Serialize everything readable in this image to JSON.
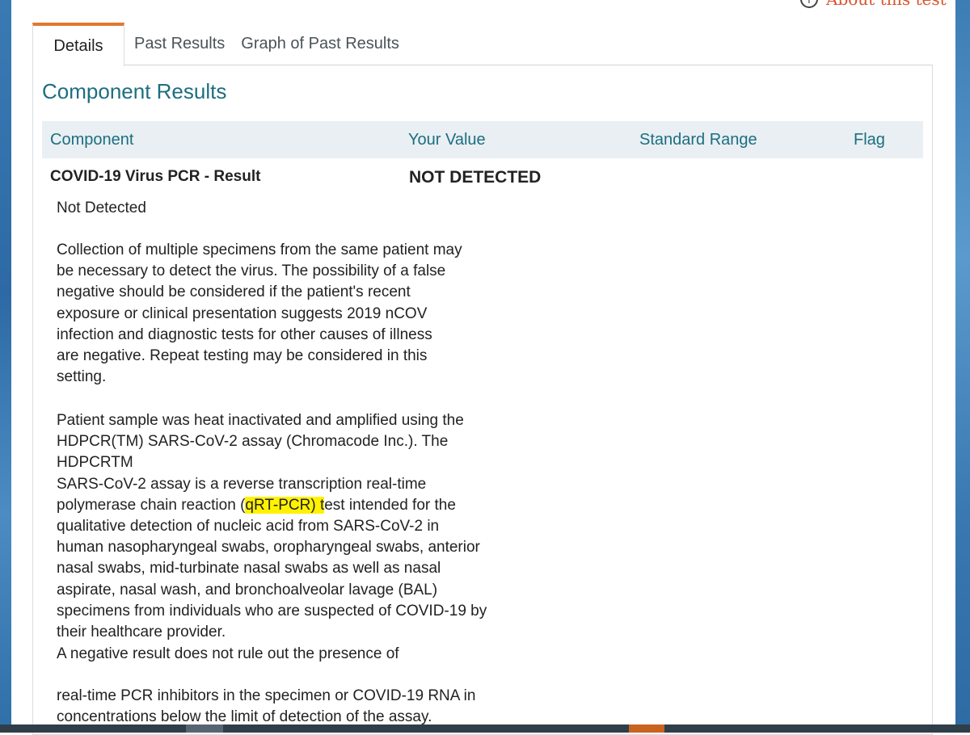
{
  "about_link": "About this test",
  "tabs": [
    {
      "label": "Details",
      "active": true
    },
    {
      "label": "Past Results",
      "active": false
    },
    {
      "label": "Graph of Past Results",
      "active": false
    }
  ],
  "section_title": "Component Results",
  "table": {
    "headers": [
      "Component",
      "Your Value",
      "Standard Range",
      "Flag"
    ],
    "row": {
      "component": "COVID-19 Virus PCR - Result",
      "value": "NOT DETECTED",
      "range": "",
      "flag": ""
    }
  },
  "comment": {
    "p1": "Not Detected",
    "p2": "Collection of multiple specimens from the same patient may\nbe necessary to detect the virus. The possibility of a false\nnegative should be considered if the patient's recent\nexposure or clinical presentation suggests 2019 nCOV\ninfection and diagnostic tests for other causes of illness\nare negative. Repeat testing may be considered in this\nsetting.",
    "p3_before": "Patient sample was heat inactivated and amplified using the\nHDPCR(TM) SARS-CoV-2 assay (Chromacode Inc.). The HDPCRTM\nSARS-CoV-2 assay is a reverse transcription real-time\npolymerase chain reaction (",
    "p3_highlight": "qRT-PCR) t",
    "p3_after": "est intended for the\nqualitative detection of nucleic acid from SARS-CoV-2 in\nhuman nasopharyngeal swabs, oropharyngeal swabs, anterior\nnasal swabs, mid-turbinate nasal swabs as well as nasal\naspirate, nasal wash, and bronchoalveolar lavage (BAL)\nspecimens from individuals who are suspected of COVID-19 by\ntheir healthcare provider.",
    "p4": "A negative result does not rule out the presence of",
    "p5": "real-time PCR inhibitors in the specimen or COVID-19 RNA in\nconcentrations below the limit of detection of the assay."
  },
  "colors": {
    "accent": "#e0792f",
    "heading": "#1d6e80",
    "highlight": "#fff200",
    "link": "#d9542a"
  }
}
